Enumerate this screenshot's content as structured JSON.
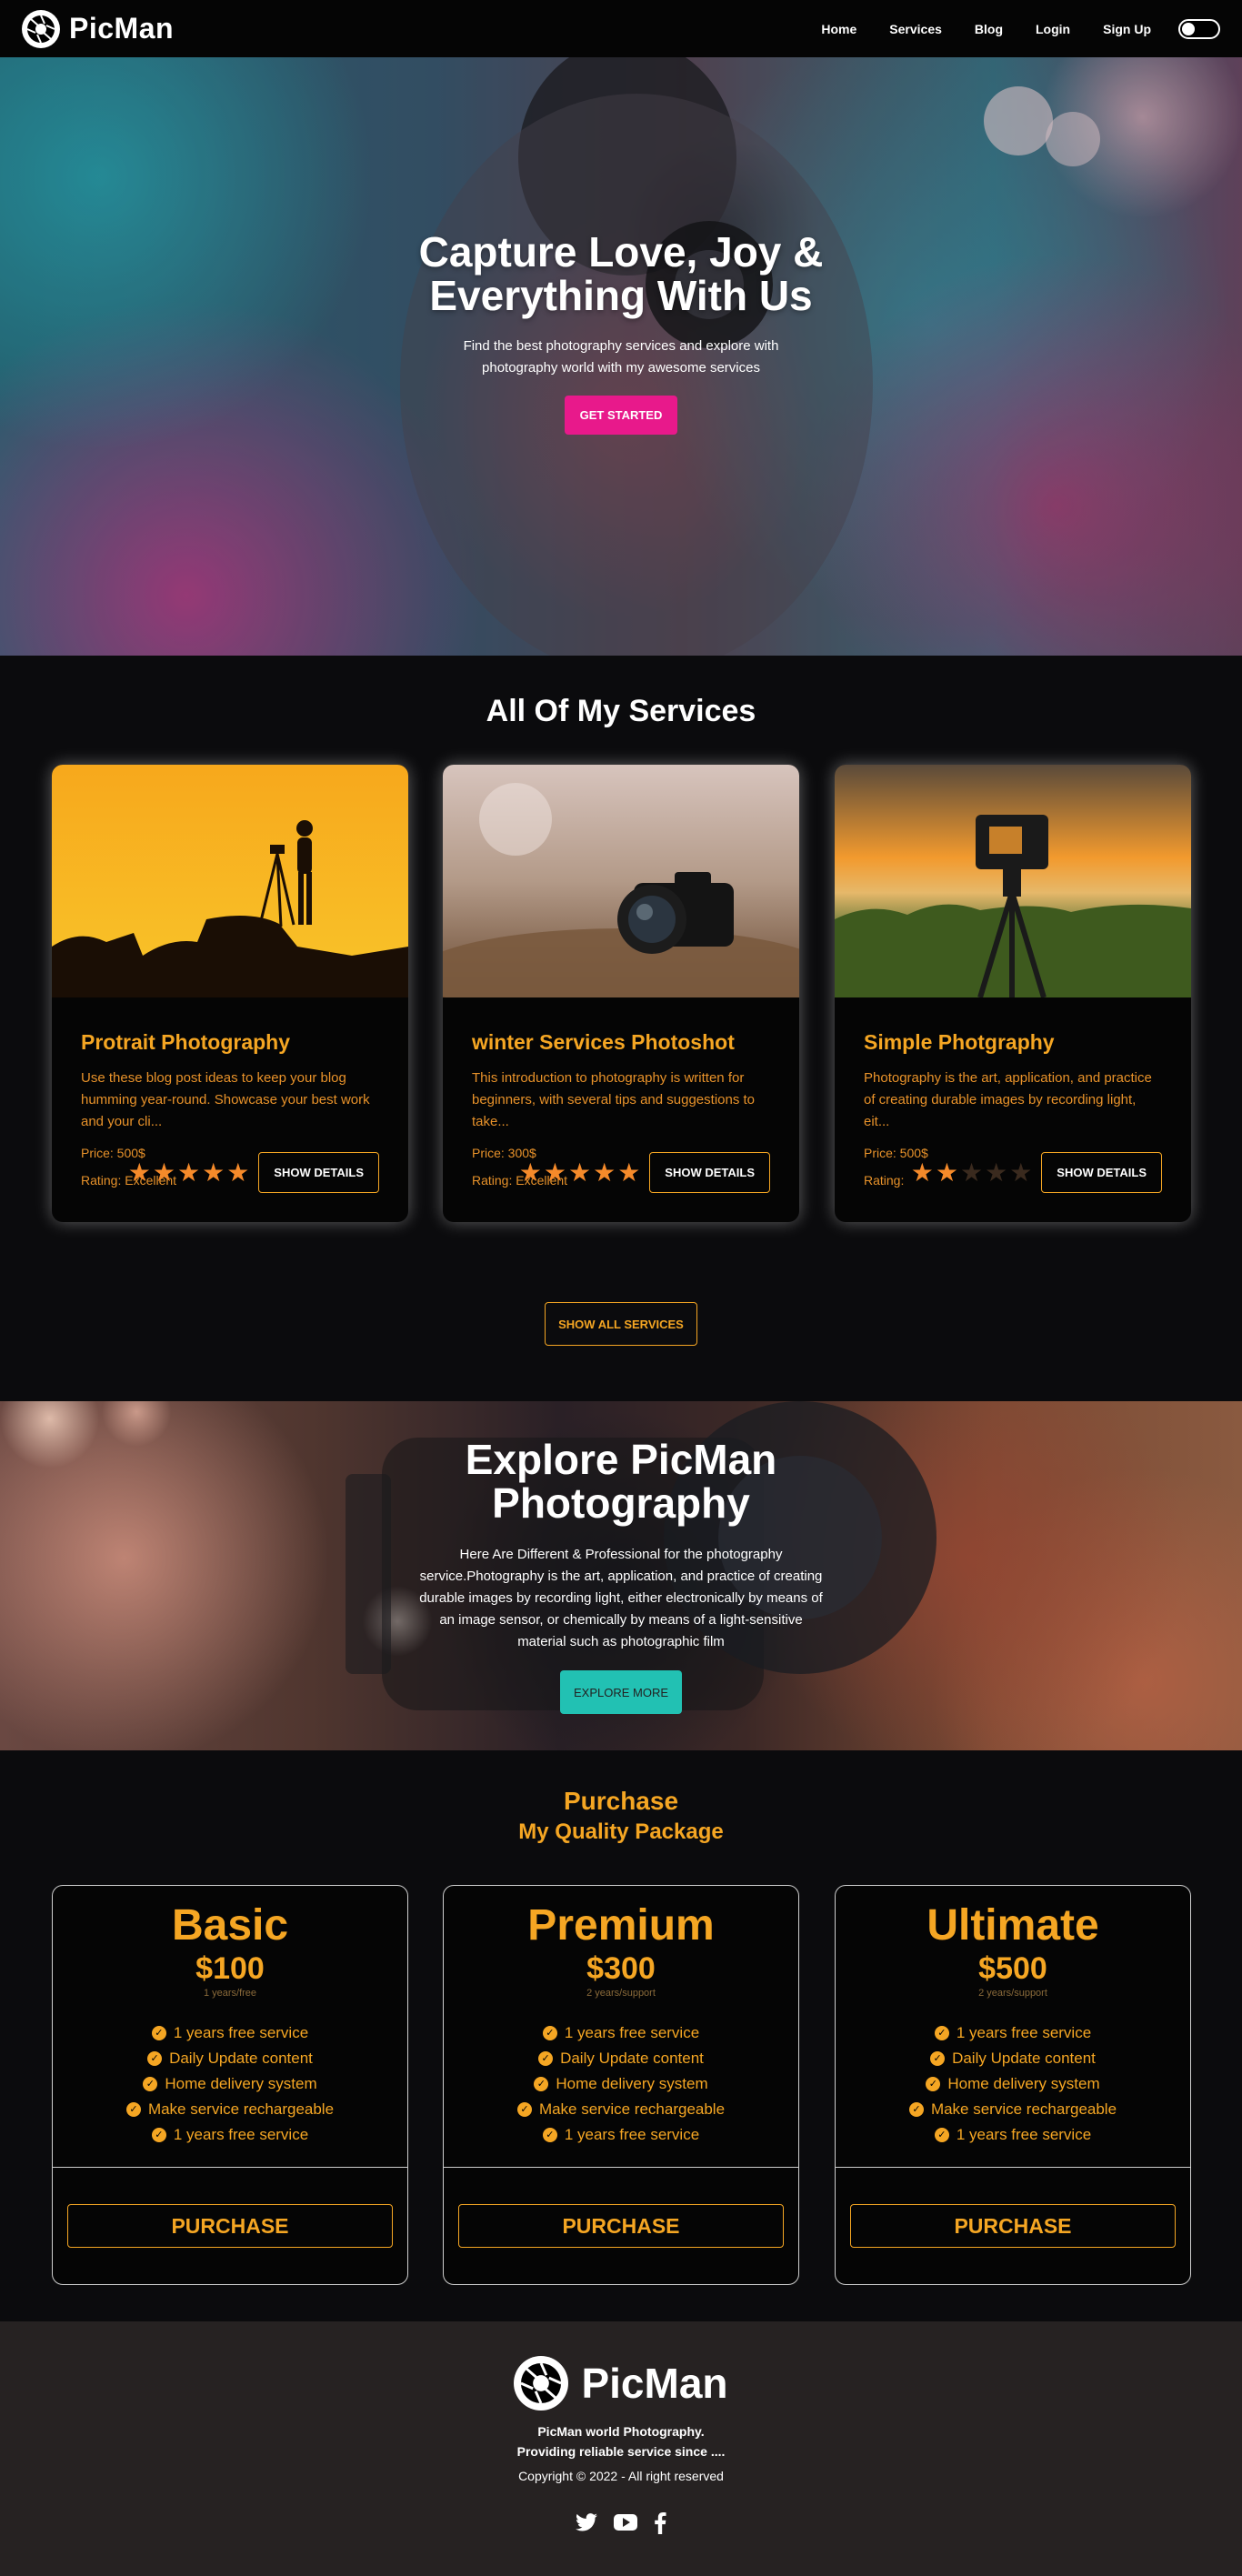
{
  "nav": {
    "brand": "PicMan",
    "links": [
      "Home",
      "Services",
      "Blog",
      "Login",
      "Sign Up"
    ]
  },
  "hero": {
    "title": "Capture Love, Joy & Everything With Us",
    "subtitle": "Find the best photography services and explore with photography world with my awesome services",
    "cta": "GET STARTED"
  },
  "services": {
    "title": "All Of My Services",
    "cards": [
      {
        "title": "Protrait Photography",
        "description": "Use these blog post ideas to keep your blog humming year-round. Showcase your best work and your cli...",
        "price": "Price: 500$",
        "rating_label": "Rating: Excellent",
        "stars": 5,
        "button": "SHOW DETAILS"
      },
      {
        "title": "winter Services Photoshot",
        "description": "This introduction to photography is written for beginners, with several tips and suggestions to take...",
        "price": "Price: 300$",
        "rating_label": "Rating: Excellent",
        "stars": 5,
        "button": "SHOW DETAILS"
      },
      {
        "title": "Simple Photgraphy",
        "description": "Photography is the art, application, and practice of creating durable images by recording light, eit...",
        "price": "Price: 500$",
        "rating_label": "Rating:",
        "stars": 2,
        "button": "SHOW DETAILS"
      }
    ],
    "show_all": "SHOW ALL SERVICES"
  },
  "explore": {
    "title": "Explore PicMan Photography",
    "text": "Here Are Different & Professional for the photography service.Photography is the art, application, and practice of creating durable images by recording light, either electronically by means of an image sensor, or chemically by means of a light-sensitive material such as photographic film",
    "button": "EXPLORE MORE"
  },
  "pricing": {
    "heading": "Purchase",
    "subheading": "My Quality Package",
    "plans": [
      {
        "name": "Basic",
        "price": "$100",
        "period": "1 years/free",
        "features": [
          "1 years free service",
          "Daily Update content",
          "Home delivery system",
          "Make service rechargeable",
          "1 years free service"
        ],
        "button": "PURCHASE"
      },
      {
        "name": "Premium",
        "price": "$300",
        "period": "2 years/support",
        "features": [
          "1 years free service",
          "Daily Update content",
          "Home delivery system",
          "Make service rechargeable",
          "1 years free service"
        ],
        "button": "PURCHASE"
      },
      {
        "name": "Ultimate",
        "price": "$500",
        "period": "2 years/support",
        "features": [
          "1 years free service",
          "Daily Update content",
          "Home delivery system",
          "Make service rechargeable",
          "1 years free service"
        ],
        "button": "PURCHASE"
      }
    ]
  },
  "footer": {
    "brand": "PicMan",
    "tagline_1": "PicMan world Photography.",
    "tagline_2": "Providing reliable service since ....",
    "copyright": "Copyright © 2022 - All right reserved",
    "social_icons": [
      "twitter-icon",
      "youtube-icon",
      "facebook-icon"
    ]
  },
  "colors": {
    "accent": "#f5a623",
    "hero_button": "#e8198b",
    "explore_button": "#22c1b3",
    "star": "#f58a2a"
  }
}
